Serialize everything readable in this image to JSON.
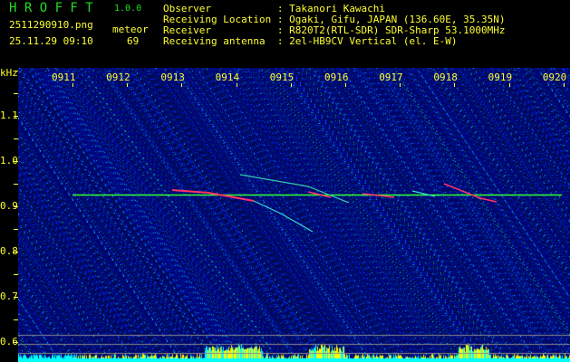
{
  "header": {
    "app_name": "H R O F F T",
    "version": "1.0.0",
    "filename": "2511290910.png",
    "datetime": "25.11.29 09:10",
    "meteor_label": "meteor",
    "meteor_count": "69"
  },
  "info": [
    {
      "label": "Observer           ",
      "value": ": Takanori Kawachi"
    },
    {
      "label": "Receiving Location ",
      "value": ": Ogaki, Gifu, JAPAN (136.60E, 35.35N)"
    },
    {
      "label": "Receiver           ",
      "value": ": R820T2(RTL-SDR) SDR-Sharp 53.1000MHz"
    },
    {
      "label": "Receiving antenna  ",
      "value": ": 2el-HB9CV Vertical (el. E-W)"
    }
  ],
  "axis": {
    "y_unit": "kHz",
    "y_ticks": [
      "1.1",
      "1.0",
      "0.9",
      "0.8",
      "0.7",
      "0.6"
    ],
    "time_ticks": [
      "0911",
      "0912",
      "0913",
      "0914",
      "0915",
      "0916",
      "0917",
      "0918",
      "0919",
      "0920"
    ]
  },
  "colors": {
    "text": "#ffff33",
    "title": "#22dd22",
    "carrier": "#33ff33",
    "meteor": "#ff3366",
    "cyan": "#00ffff"
  }
}
